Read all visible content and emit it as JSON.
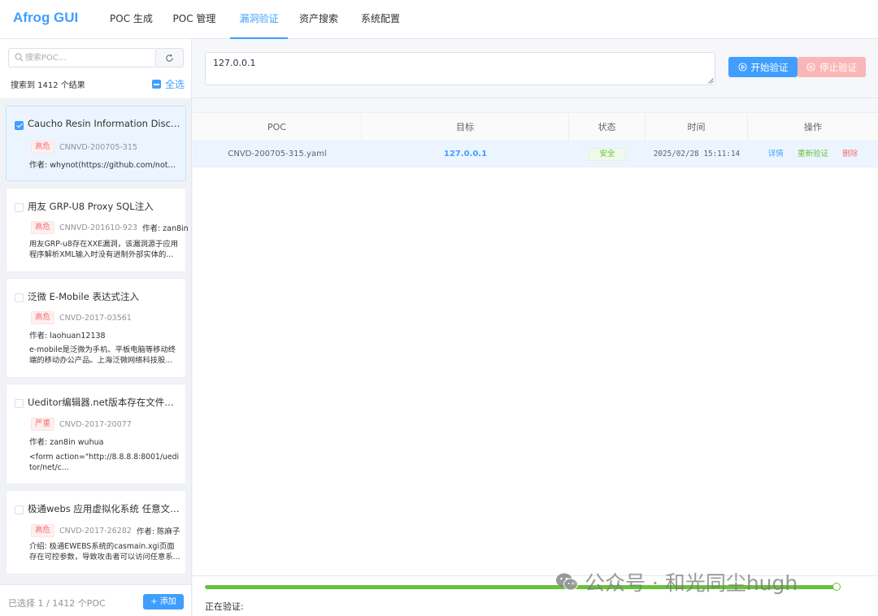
{
  "app": {
    "title": "Afrog GUI",
    "nav": [
      "POC 生成",
      "POC 管理",
      "漏洞验证",
      "资产搜索",
      "系统配置"
    ],
    "active_nav": "漏洞验证"
  },
  "sidebar": {
    "search_placeholder": "搜索POC...",
    "result_count": "搜索到 1412 个结果",
    "select_all_label": "全选",
    "cards": [
      {
        "title": "Caucho Resin Information Disclosure",
        "severity": "高危",
        "id": "CNNVD-200705-315",
        "author": "作者: whynot(https://github.com/notwhy)",
        "checked": true
      },
      {
        "title": "用友 GRP-U8 Proxy SQL注入",
        "severity": "高危",
        "id": "CNNVD-201610-923",
        "author": "作者: zan8in",
        "description": "用友GRP-u8存在XXE漏洞，该漏洞源于应用程序解析XML输入时没有进制外部实体的...",
        "checked": false
      },
      {
        "title": "泛微 E-Mobile 表达式注入",
        "severity": "高危",
        "id": "CNVD-2017-03561",
        "author": "作者: laohuan12138",
        "description": "e-mobile是泛微为手机、平板电脑等移动终端的移动办公产品。上海泛微网络科技股...",
        "checked": false
      },
      {
        "title": "Ueditor编辑器.net版本存在文件上...",
        "severity": "严重",
        "id": "CNVD-2017-20077",
        "author": "作者: zan8in wuhua",
        "description": "<form action=\"http://8.8.8.8:8001/ueditor/net/c...",
        "checked": false
      },
      {
        "title": "极通webs 应用虚拟化系统 任意文件...",
        "severity": "高危",
        "id": "CNVD-2017-26282",
        "author": "作者: 陈麻子",
        "description": "介绍: 极通EWEBS系统的casmain.xgi页面存在可控参数，导致攻击者可以访问任意系...",
        "checked": false
      }
    ],
    "footer_selected": "已选择 1 / 1412 个POC",
    "add_button": "+ 添加"
  },
  "main": {
    "target_value": "127.0.0.1",
    "start_button": "开始验证",
    "stop_button": "停止验证",
    "table": {
      "headers": [
        "POC",
        "目标",
        "状态",
        "时间",
        "操作"
      ],
      "rows": [
        {
          "poc": "CNVD-200705-315.yaml",
          "target": "127.0.0.1",
          "status": "安全",
          "time": "2025/02/28 15:11:14",
          "actions": [
            "详情",
            "重新验证",
            "删除"
          ]
        }
      ]
    },
    "progress": 1.0,
    "status_label": "正在验证:"
  },
  "watermark": "公众号 · 和光同尘hugh",
  "colors": {
    "primary": "#409eff",
    "danger": "#f56c6c",
    "success": "#67c23a"
  }
}
